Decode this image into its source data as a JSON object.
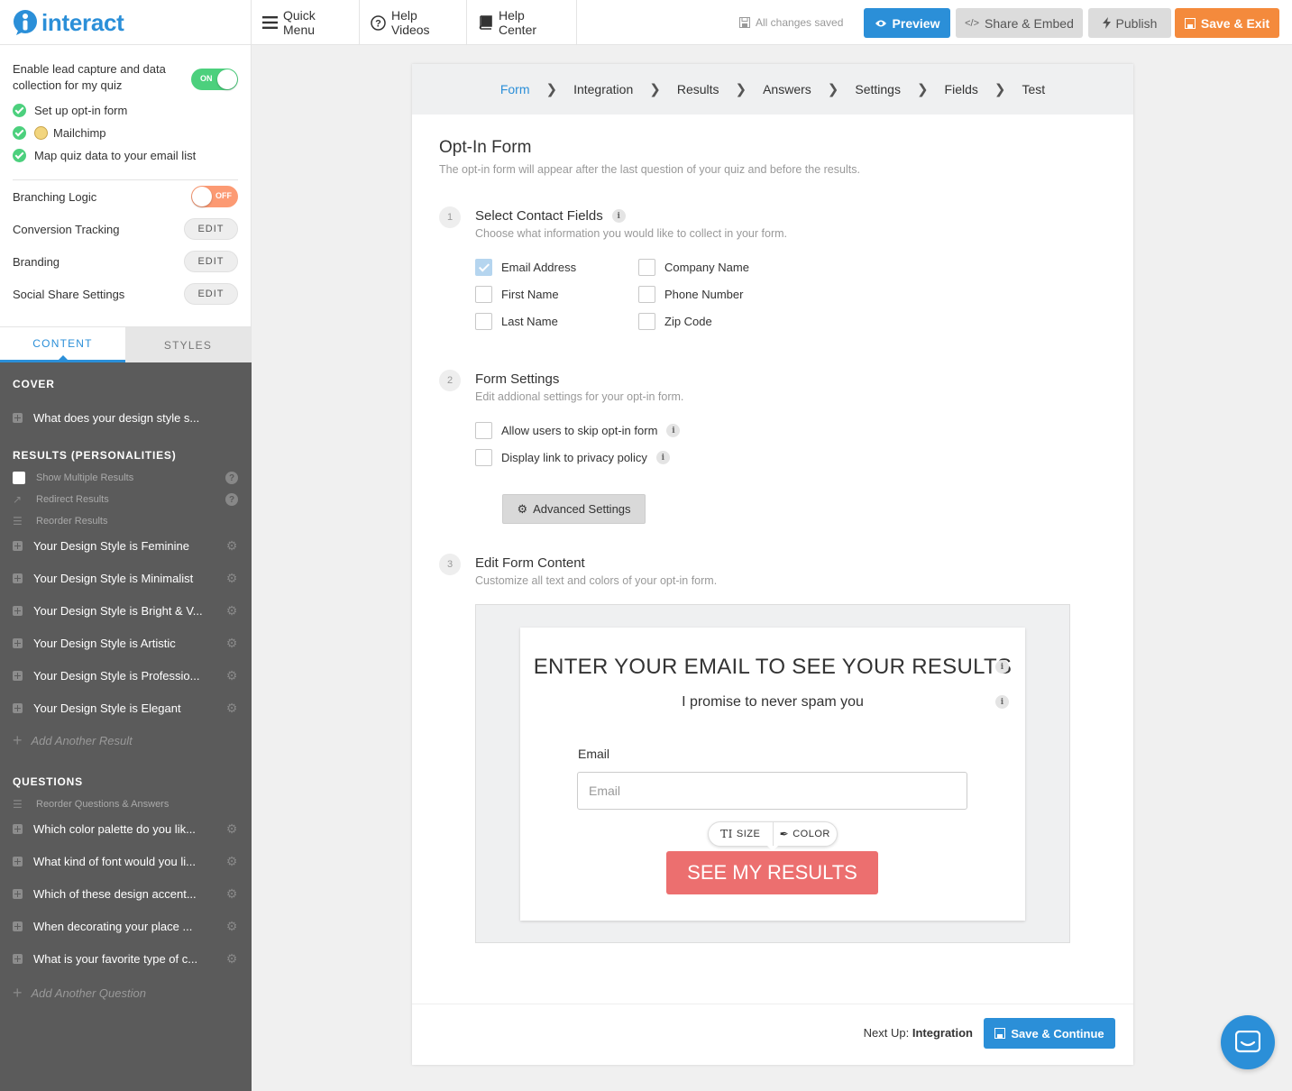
{
  "brand": {
    "logo_text": "interact",
    "accent": "#2b8fd8"
  },
  "topnav": {
    "quick_menu": "Quick Menu",
    "help_videos": "Help Videos",
    "help_center": "Help Center",
    "saved_status": "All changes saved",
    "preview": "Preview",
    "share_embed": "Share & Embed",
    "publish": "Publish",
    "save_exit": "Save & Exit"
  },
  "sidebar": {
    "lead_capture": {
      "label": "Enable lead capture and data collection for my quiz",
      "toggle": "ON",
      "checklist": [
        "Set up opt-in form",
        "Mailchimp",
        "Map quiz data to your email list"
      ]
    },
    "settings": [
      {
        "label": "Branching Logic",
        "control": "OFF"
      },
      {
        "label": "Conversion Tracking",
        "control": "EDIT"
      },
      {
        "label": "Branding",
        "control": "EDIT"
      },
      {
        "label": "Social Share Settings",
        "control": "EDIT"
      }
    ],
    "tabs": {
      "content": "CONTENT",
      "styles": "STYLES"
    },
    "cover": {
      "heading": "COVER",
      "item": "What does your design style s..."
    },
    "results": {
      "heading": "RESULTS (PERSONALITIES)",
      "options": [
        "Show Multiple Results",
        "Redirect Results",
        "Reorder Results"
      ],
      "items": [
        "Your Design Style is Feminine",
        "Your Design Style is Minimalist",
        "Your Design Style is Bright & V...",
        "Your Design Style is Artistic",
        "Your Design Style is Professio...",
        "Your Design Style is Elegant"
      ],
      "add": "Add Another Result"
    },
    "questions": {
      "heading": "QUESTIONS",
      "reorder": "Reorder Questions & Answers",
      "items": [
        "Which color palette do you lik...",
        "What kind of font would you li...",
        "Which of these design accent...",
        "When decorating your place ...",
        "What is your favorite type of c..."
      ],
      "add": "Add Another Question"
    }
  },
  "steps": [
    "Form",
    "Integration",
    "Results",
    "Answers",
    "Settings",
    "Fields",
    "Test"
  ],
  "form": {
    "title": "Opt-In Form",
    "subtitle": "The opt-in form will appear after the last question of your quiz and before the results.",
    "section1": {
      "num": "1",
      "title": "Select Contact Fields",
      "subtitle": "Choose what information you would like to collect in your form.",
      "fields": [
        {
          "label": "Email Address",
          "checked": true
        },
        {
          "label": "First Name",
          "checked": false
        },
        {
          "label": "Last Name",
          "checked": false
        },
        {
          "label": "Company Name",
          "checked": false
        },
        {
          "label": "Phone Number",
          "checked": false
        },
        {
          "label": "Zip Code",
          "checked": false
        }
      ]
    },
    "section2": {
      "num": "2",
      "title": "Form Settings",
      "subtitle": "Edit addional settings for your opt-in form.",
      "options": [
        "Allow users to skip opt-in form",
        "Display link to privacy policy"
      ],
      "advanced": "Advanced Settings"
    },
    "section3": {
      "num": "3",
      "title": "Edit Form Content",
      "subtitle": "Customize all text and colors of your opt-in form."
    },
    "preview": {
      "heading": "ENTER YOUR EMAIL TO SEE YOUR RESULTS",
      "subheading": "I promise to never spam you",
      "email_label": "Email",
      "email_placeholder": "Email",
      "tool_size": "SIZE",
      "tool_color": "COLOR",
      "button": "SEE MY RESULTS",
      "button_color": "#ec6f6f"
    }
  },
  "footer": {
    "next_prefix": "Next Up:",
    "next_step": "Integration",
    "save_continue": "Save & Continue"
  }
}
